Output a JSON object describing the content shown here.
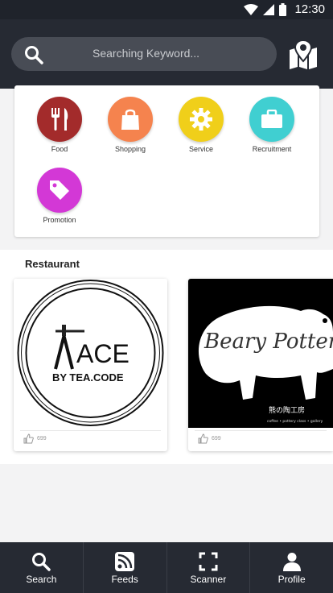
{
  "status_bar": {
    "time": "12:30",
    "icons": [
      "wifi-icon",
      "signal-icon",
      "battery-icon"
    ]
  },
  "header": {
    "search_placeholder": "Searching Keyword...",
    "icons": [
      "search-icon",
      "map-pin-icon"
    ]
  },
  "categories": [
    {
      "label": "Food",
      "icon": "fork-knife-icon",
      "color": "#a32b2b"
    },
    {
      "label": "Shopping",
      "icon": "shopping-bag-icon",
      "color": "#f5834e"
    },
    {
      "label": "Service",
      "icon": "gear-icon",
      "color": "#f0cf1a"
    },
    {
      "label": "Recruitment",
      "icon": "briefcase-icon",
      "color": "#40cfd1"
    },
    {
      "label": "Promotion",
      "icon": "tag-icon",
      "color": "#d338d6"
    }
  ],
  "restaurant_section": {
    "title": "Restaurant",
    "cards": [
      {
        "logo_text": "ACE",
        "logo_subtext": "BY TEA.CODE",
        "likes": "699"
      },
      {
        "logo_text": "Beary Potter",
        "logo_subtext": "熊の陶工房",
        "logo_small": "coffee • pottery class • gallery",
        "likes": "699"
      }
    ]
  },
  "bottom_nav": [
    {
      "label": "Search",
      "icon": "search-icon"
    },
    {
      "label": "Feeds",
      "icon": "rss-feed-icon"
    },
    {
      "label": "Scanner",
      "icon": "scanner-icon"
    },
    {
      "label": "Profile",
      "icon": "user-icon"
    }
  ],
  "colors": {
    "header": "#262a33",
    "background": "#f3f3f4"
  }
}
